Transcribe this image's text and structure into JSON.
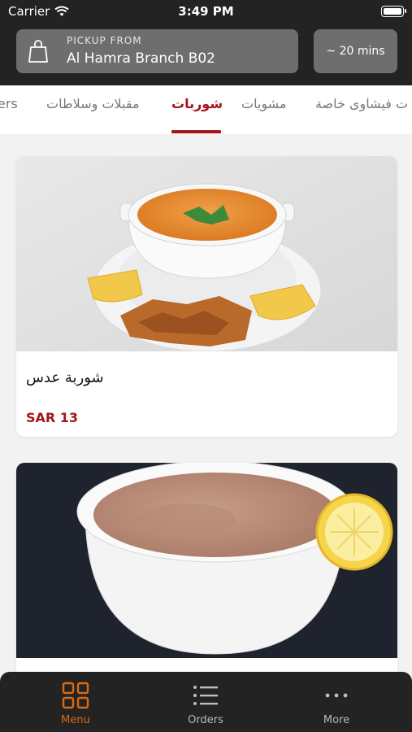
{
  "status_bar": {
    "carrier": "Carrier",
    "time": "3:49 PM"
  },
  "pickup": {
    "label": "PICKUP FROM",
    "branch": "Al Hamra Branch B02"
  },
  "eta": "~ 20 mins",
  "tabs": [
    {
      "label": "ers"
    },
    {
      "label": "مقبلات وسلاطات"
    },
    {
      "label": "شوربات"
    },
    {
      "label": "مشويات"
    },
    {
      "label": "ت فيشاوى خاصة"
    }
  ],
  "active_tab": "شوربات",
  "items": [
    {
      "name": "شوربة عدس",
      "price": "SAR 13",
      "image": "lentil-soup-photo"
    },
    {
      "name": "",
      "price": "",
      "image": "orzo-soup-photo"
    }
  ],
  "bottom_nav": [
    {
      "label": "Menu",
      "icon": "grid-icon"
    },
    {
      "label": "Orders",
      "icon": "list-icon"
    },
    {
      "label": "More",
      "icon": "more-dots-icon"
    }
  ],
  "colors": {
    "header_bg": "#232323",
    "accent": "#a3161b",
    "nav_active": "#d86b14"
  }
}
